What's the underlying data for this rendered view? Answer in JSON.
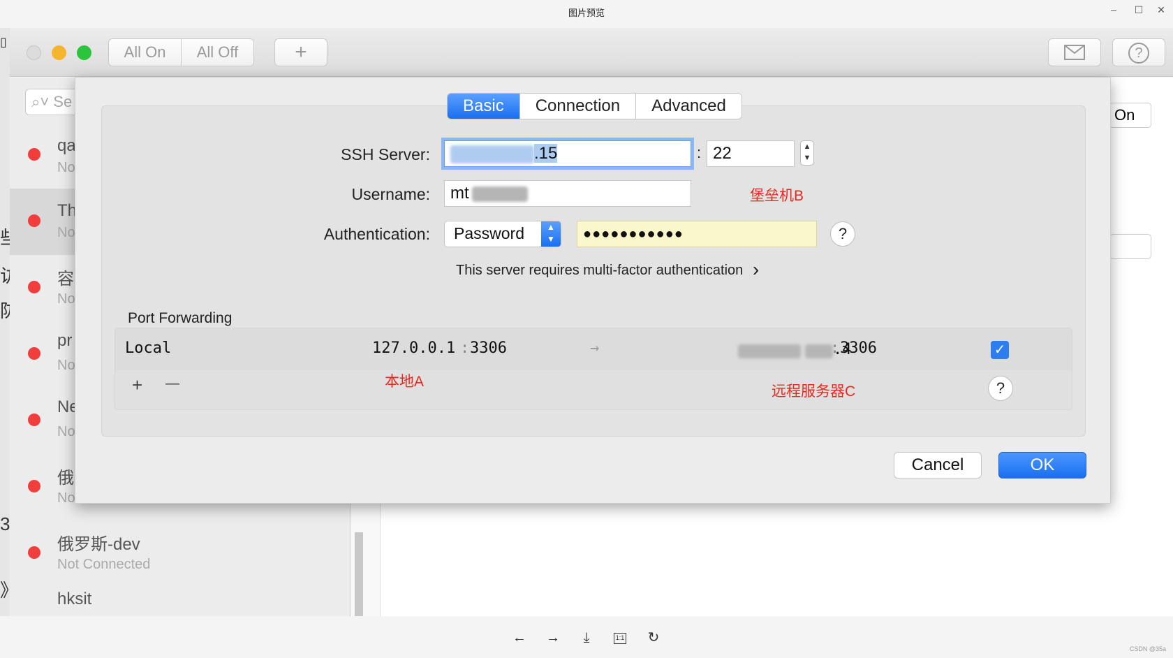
{
  "viewer": {
    "title": "图片预览",
    "controls": {
      "minimize": "–",
      "maximize": "☐",
      "close": "✕"
    },
    "bottom_icons": [
      "arrow-left-icon",
      "arrow-right-icon",
      "download-icon",
      "actual-size-icon",
      "rotate-icon"
    ],
    "bottom_glyphs": {
      "prev": "←",
      "next": "→",
      "download": "⤓",
      "actual": "1:1",
      "rotate": "↻"
    },
    "watermark": "CSDN @35a"
  },
  "app": {
    "toolbar": {
      "all_on": "All On",
      "all_off": "All Off",
      "add": "+",
      "mail_icon": "mail-icon",
      "help": "?"
    },
    "search_placeholder": "Se",
    "sidebar": [
      {
        "name": "qa",
        "status": "No"
      },
      {
        "name": "Th",
        "status": "No"
      },
      {
        "name": "容",
        "status": "No"
      },
      {
        "name": "pr",
        "status": "No"
      },
      {
        "name": "Ne",
        "status": "No"
      },
      {
        "name": "俄",
        "status": "Not Connected"
      },
      {
        "name": "俄罗斯-dev",
        "status": "Not Connected"
      },
      {
        "name": "hksit",
        "status": ""
      }
    ],
    "right_peek_label": "On",
    "left_strip": [
      "些",
      "访",
      "防",
      "3",
      "》"
    ]
  },
  "dialog": {
    "tabs": [
      {
        "label": "Basic",
        "active": true
      },
      {
        "label": "Connection",
        "active": false
      },
      {
        "label": "Advanced",
        "active": false
      }
    ],
    "ssh_server_label": "SSH Server:",
    "ssh_server_value_suffix": ".15",
    "port_separator": ":",
    "port_value": "22",
    "username_label": "Username:",
    "username_value": "mt",
    "annotation_bastion": "堡垒机B",
    "auth_label": "Authentication:",
    "auth_method": "Password",
    "password_mask": "●●●●●●●●●●●",
    "help": "?",
    "mfa_text": "This server requires multi-factor authentication",
    "mfa_chevron": "›",
    "port_forwarding_label": "Port Forwarding",
    "forward": {
      "type": "Local",
      "local_host": "127.0.0.1",
      "local_port": "3306",
      "arrow": "→",
      "remote_host_suffix": ".4",
      "remote_port": "3306",
      "colon": ":",
      "enabled": true,
      "check": "✓"
    },
    "annotation_local": "本地A",
    "annotation_remote": "远程服务器C",
    "add": "+",
    "remove": "—",
    "cancel": "Cancel",
    "ok": "OK"
  },
  "colors": {
    "accent": "#1a6ff0",
    "annotation": "#e8281e",
    "status_dot": "#f23d3d",
    "password_bg": "#fbf7cc"
  }
}
